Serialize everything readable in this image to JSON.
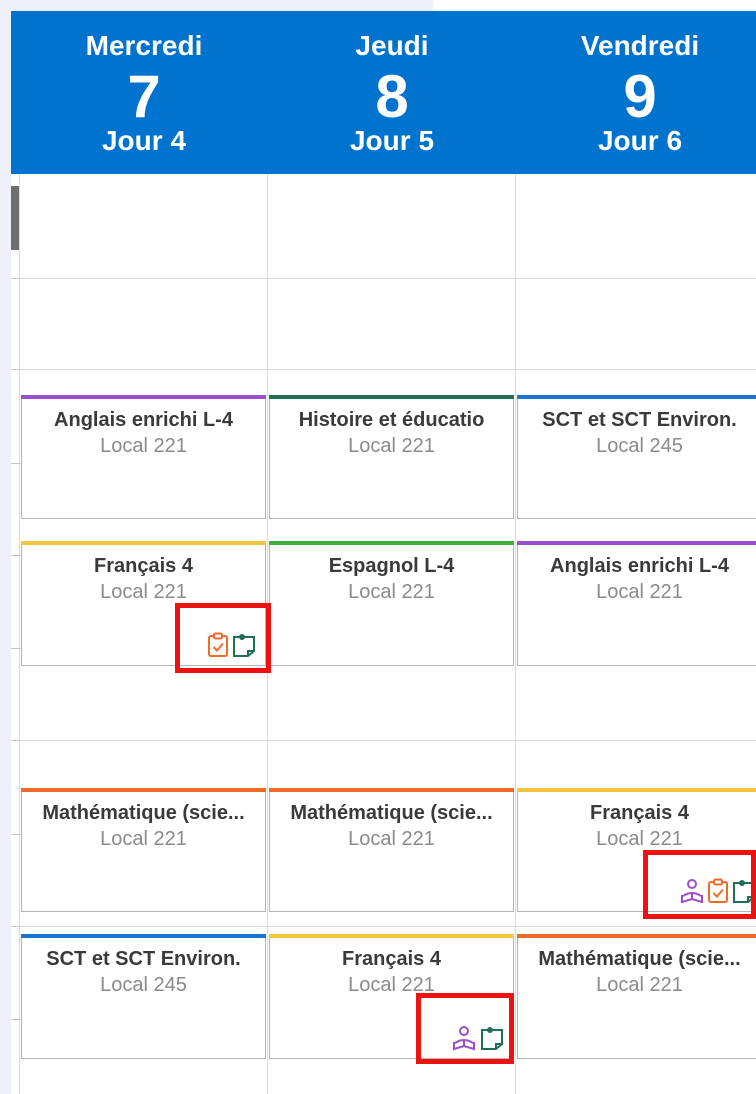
{
  "days": [
    {
      "name": "Mercredi",
      "number": "7",
      "cycle": "Jour 4"
    },
    {
      "name": "Jeudi",
      "number": "8",
      "cycle": "Jour 5"
    },
    {
      "name": "Vendredi",
      "number": "9",
      "cycle": "Jour 6"
    }
  ],
  "events": {
    "wed_1": {
      "title": "Anglais enrichi L-4",
      "room": "Local 221"
    },
    "thu_1": {
      "title": "Histoire et éducatio",
      "room": "Local 221"
    },
    "fri_1": {
      "title": "SCT et SCT Environ.",
      "room": "Local 245"
    },
    "wed_2": {
      "title": "Français 4",
      "room": "Local 221"
    },
    "thu_2": {
      "title": "Espagnol L-4",
      "room": "Local 221"
    },
    "fri_2": {
      "title": "Anglais enrichi L-4",
      "room": "Local 221"
    },
    "wed_3": {
      "title": "Mathématique (scie...",
      "room": "Local 221"
    },
    "thu_3": {
      "title": "Mathématique (scie...",
      "room": "Local 221"
    },
    "fri_3": {
      "title": "Français 4",
      "room": "Local 221"
    },
    "wed_4": {
      "title": "SCT et SCT Environ.",
      "room": "Local 245"
    },
    "thu_4": {
      "title": "Français 4",
      "room": "Local 221"
    },
    "fri_4": {
      "title": "Mathématique (scie...",
      "room": "Local 221"
    }
  },
  "colors": {
    "header": "#0073cf",
    "english": "#9b4fcf",
    "history": "#1f6e58",
    "science": "#1a74d2",
    "french": "#f5c542",
    "spanish": "#3fae3c",
    "math": "#f06a2a",
    "highlight": "#ee1111"
  },
  "icons": [
    "assignment-icon",
    "note-icon",
    "student-reading-icon"
  ]
}
